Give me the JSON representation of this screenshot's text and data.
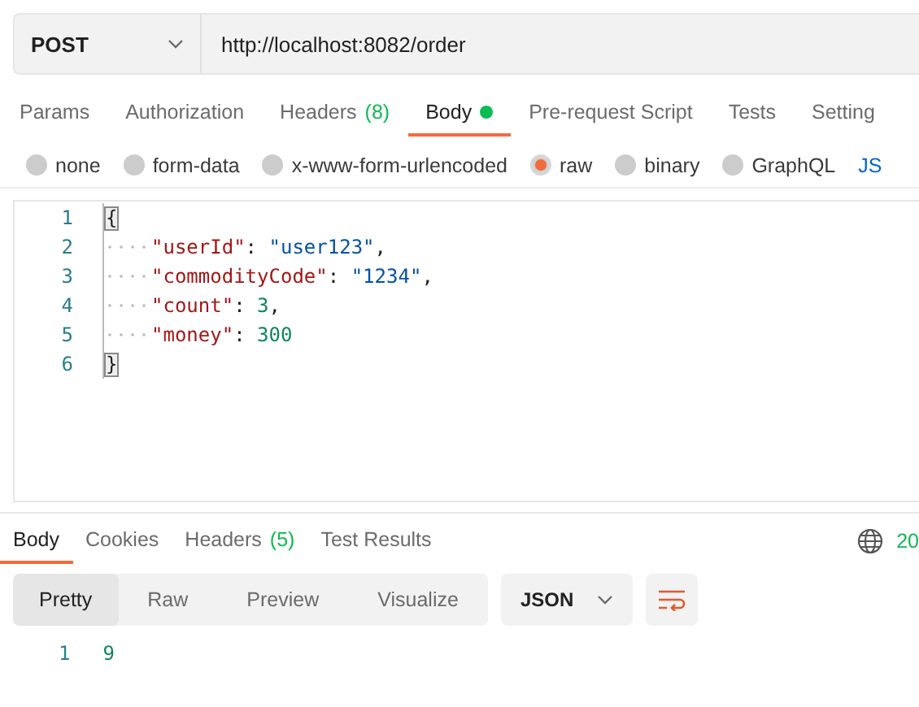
{
  "request": {
    "method": "POST",
    "url": "http://localhost:8082/order"
  },
  "tabs": [
    {
      "label": "Params",
      "selected": false,
      "dot": false
    },
    {
      "label": "Authorization",
      "selected": false,
      "dot": false
    },
    {
      "label": "Headers",
      "count": "(8)",
      "selected": false,
      "dot": false
    },
    {
      "label": "Body",
      "selected": true,
      "dot": true
    },
    {
      "label": "Pre-request Script",
      "selected": false,
      "dot": false
    },
    {
      "label": "Tests",
      "selected": false,
      "dot": false
    },
    {
      "label": "Setting",
      "selected": false,
      "dot": false
    }
  ],
  "body_types": [
    {
      "label": "none",
      "selected": false
    },
    {
      "label": "form-data",
      "selected": false
    },
    {
      "label": "x-www-form-urlencoded",
      "selected": false
    },
    {
      "label": "raw",
      "selected": true
    },
    {
      "label": "binary",
      "selected": false
    },
    {
      "label": "GraphQL",
      "selected": false
    }
  ],
  "body_format": "JS",
  "editor": {
    "lines": [
      {
        "number": "1",
        "indent": false,
        "tokens": [
          {
            "kind": "bracket",
            "text": "{"
          }
        ]
      },
      {
        "number": "2",
        "indent": true,
        "tokens": [
          {
            "kind": "key",
            "text": "\"userId\""
          },
          {
            "kind": "punct",
            "text": ": "
          },
          {
            "kind": "string",
            "text": "\"user123\""
          },
          {
            "kind": "punct",
            "text": ","
          }
        ]
      },
      {
        "number": "3",
        "indent": true,
        "tokens": [
          {
            "kind": "key",
            "text": "\"commodityCode\""
          },
          {
            "kind": "punct",
            "text": ": "
          },
          {
            "kind": "string",
            "text": "\"1234\""
          },
          {
            "kind": "punct",
            "text": ","
          }
        ]
      },
      {
        "number": "4",
        "indent": true,
        "tokens": [
          {
            "kind": "key",
            "text": "\"count\""
          },
          {
            "kind": "punct",
            "text": ": "
          },
          {
            "kind": "number",
            "text": "3"
          },
          {
            "kind": "punct",
            "text": ","
          }
        ]
      },
      {
        "number": "5",
        "indent": true,
        "tokens": [
          {
            "kind": "key",
            "text": "\"money\""
          },
          {
            "kind": "punct",
            "text": ": "
          },
          {
            "kind": "number",
            "text": "300"
          }
        ]
      },
      {
        "number": "6",
        "indent": false,
        "tokens": [
          {
            "kind": "bracket",
            "text": "}"
          }
        ]
      }
    ]
  },
  "response": {
    "tabs": [
      {
        "label": "Body",
        "selected": true
      },
      {
        "label": "Cookies",
        "selected": false
      },
      {
        "label": "Headers",
        "count": "(5)",
        "selected": false
      },
      {
        "label": "Test Results",
        "selected": false
      }
    ],
    "status": "20",
    "views": [
      {
        "label": "Pretty",
        "selected": true
      },
      {
        "label": "Raw",
        "selected": false
      },
      {
        "label": "Preview",
        "selected": false
      },
      {
        "label": "Visualize",
        "selected": false
      }
    ],
    "format": "JSON",
    "lines": [
      {
        "number": "1",
        "text": "9"
      }
    ]
  }
}
